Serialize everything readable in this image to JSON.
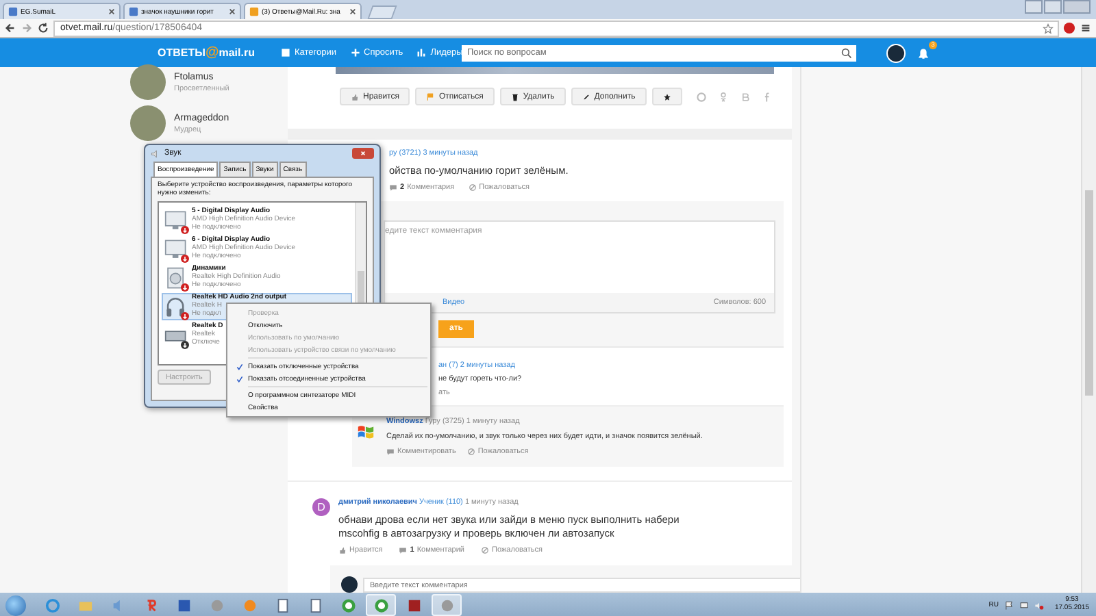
{
  "browser": {
    "tabs": [
      {
        "title": "EG.SumaiL",
        "selected": false
      },
      {
        "title": "значок наушники горит",
        "selected": false
      },
      {
        "title": "(3) Ответы@Mail.Ru: зна",
        "selected": true
      }
    ],
    "url_host": "otvet.mail.ru",
    "url_path": "/question/178506404"
  },
  "header": {
    "logo_word": "ОТВЕТЫ",
    "logo_at": "@",
    "logo_domain": "mail.ru",
    "nav": [
      {
        "label": "Категории",
        "kind": "grid"
      },
      {
        "label": "Спросить",
        "kind": "plus"
      },
      {
        "label": "Лидеры",
        "kind": "bars"
      }
    ],
    "search": {
      "placeholder": "Поиск по вопросам"
    },
    "notification_count": "3"
  },
  "sidebar": {
    "users": [
      {
        "name": "Ftolamus",
        "rank": "Просветленный"
      },
      {
        "name": "Armageddon",
        "rank": "Мудрец"
      }
    ]
  },
  "question_actions": [
    {
      "label": "Нравится",
      "kind": "like"
    },
    {
      "label": "Отписаться",
      "kind": "flag"
    },
    {
      "label": "Удалить",
      "kind": "delete"
    },
    {
      "label": "Дополнить",
      "kind": "edit"
    },
    {
      "kind": "star"
    }
  ],
  "answer_1": {
    "meta": "ру (3721) 3 минуты назад",
    "text": "ойства по-умолчанию горит зелёным.",
    "comments_count": "2",
    "comments_label": "Комментария",
    "report": "Пожаловаться",
    "comment_form": {
      "placeholder": "едите текст комментария",
      "video_link": "Видео",
      "chars": "Символов: 600",
      "submit": "ать"
    },
    "reply_1": {
      "meta": "ан (7) 2 минуты назад",
      "text": "не будут гореть что-ли?",
      "action": "ать"
    },
    "reply_2": {
      "author": "Windowsz",
      "meta": "Гуру (3725) 1 минуту назад",
      "text": "Сделай их по-умолчанию, и звук только через них будет идти, и значок появится зелёный.",
      "comment": "Комментировать",
      "report": "Пожаловаться"
    }
  },
  "answer_2": {
    "avatar_letter": "D",
    "author": "дмитрий николаевич",
    "rank": "Ученик (110)",
    "time": "1 минуту назад",
    "text": "обнави дрова если нет звука или зайди в меню пуск выполнить набери mscohfig в автозагрузку и проверь включен ли автозапуск",
    "like": "Нравится",
    "comments_count": "1",
    "comments_label": "Комментарий",
    "report": "Пожаловаться",
    "comment_placeholder": "Введите текст комментария"
  },
  "sound_dialog": {
    "title": "Звук",
    "tabs": [
      {
        "label": "Воспроизведение",
        "selected": true
      },
      {
        "label": "Запись",
        "selected": false
      },
      {
        "label": "Звуки",
        "selected": false
      },
      {
        "label": "Связь",
        "selected": false
      }
    ],
    "instruction": "Выберите устройство воспроизведения, параметры которого нужно изменить:",
    "devices": [
      {
        "kind": "monitor",
        "name": "5 - Digital Display Audio",
        "driver": "AMD High Definition Audio Device",
        "status": "Не подключено",
        "disabled": false,
        "selected": false
      },
      {
        "kind": "monitor",
        "name": "6 - Digital Display Audio",
        "driver": "AMD High Definition Audio Device",
        "status": "Не подключено",
        "disabled": false,
        "selected": false
      },
      {
        "kind": "speaker",
        "name": "Динамики",
        "driver": "Realtek High Definition Audio",
        "status": "Не подключено",
        "disabled": false,
        "selected": false
      },
      {
        "kind": "headphones",
        "name": "Realtek HD Audio 2nd output",
        "driver": "Realtek H",
        "status": "Не подкл",
        "disabled": false,
        "selected": true
      },
      {
        "kind": "box",
        "name": "Realtek D",
        "driver": "Realtek",
        "status": "Отключе",
        "disabled": true,
        "selected": false
      }
    ],
    "configure_button": {
      "label": "Настроить",
      "disabled": true
    }
  },
  "context_menu": {
    "groups": [
      {
        "items": [
          {
            "label": "Проверка",
            "disabled": true,
            "checked": false
          },
          {
            "label": "Отключить",
            "disabled": false,
            "checked": false
          },
          {
            "label": "Использовать по умолчанию",
            "disabled": true,
            "checked": false
          },
          {
            "label": "Использовать устройство связи по умолчанию",
            "disabled": true,
            "checked": false
          }
        ]
      },
      {
        "items": [
          {
            "label": "Показать отключенные устройства",
            "disabled": false,
            "checked": true
          },
          {
            "label": "Показать отсоединенные устройства",
            "disabled": false,
            "checked": true
          }
        ]
      },
      {
        "items": [
          {
            "label": "О программном синтезаторе MIDI",
            "disabled": false,
            "checked": false
          },
          {
            "label": "Свойства",
            "disabled": false,
            "checked": false
          }
        ]
      }
    ]
  },
  "taskbar": {
    "apps": [
      {
        "kind": "globe",
        "selected": false
      },
      {
        "kind": "folder",
        "selected": false
      },
      {
        "kind": "speaker",
        "selected": false
      },
      {
        "kind": "letter",
        "selected": false
      },
      {
        "kind": "floppy",
        "selected": false
      },
      {
        "kind": "disc",
        "selected": false
      },
      {
        "kind": "play",
        "selected": false
      },
      {
        "kind": "document",
        "selected": false
      },
      {
        "kind": "document",
        "selected": false
      },
      {
        "kind": "ring",
        "selected": false
      },
      {
        "kind": "ring",
        "selected": true
      },
      {
        "kind": "square",
        "selected": false
      },
      {
        "kind": "disc",
        "selected": true
      }
    ],
    "language": "RU",
    "time": "9:53",
    "date": "17.05.2015"
  }
}
